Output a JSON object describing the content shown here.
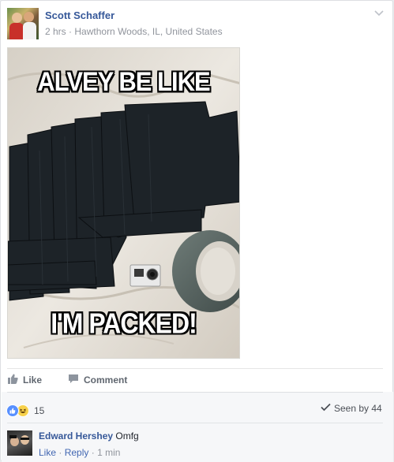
{
  "post": {
    "author": "Scott Schaffer",
    "time": "2 hrs",
    "separator": "·",
    "location": "Hawthorn Woods, IL, United States",
    "icon": "chevron-down-icon"
  },
  "photo": {
    "top_caption": "ALVEY BE LIKE",
    "bottom_caption": "I'M PACKED!"
  },
  "actions": {
    "like_label": "Like",
    "comment_label": "Comment",
    "like_icon": "thumbs-up-icon",
    "comment_icon": "speech-bubble-icon"
  },
  "reactions": {
    "count": "15",
    "types": [
      "like",
      "haha"
    ],
    "seen_label": "Seen by 44"
  },
  "comment": {
    "author": "Edward Hershey",
    "text": "Omfg",
    "like_label": "Like",
    "reply_label": "Reply",
    "sep": "·",
    "time": "1 min"
  },
  "colors": {
    "link": "#365899",
    "muted": "#90949c",
    "like_blue": "#5890ff",
    "haha_yellow": "#f7d14b"
  }
}
